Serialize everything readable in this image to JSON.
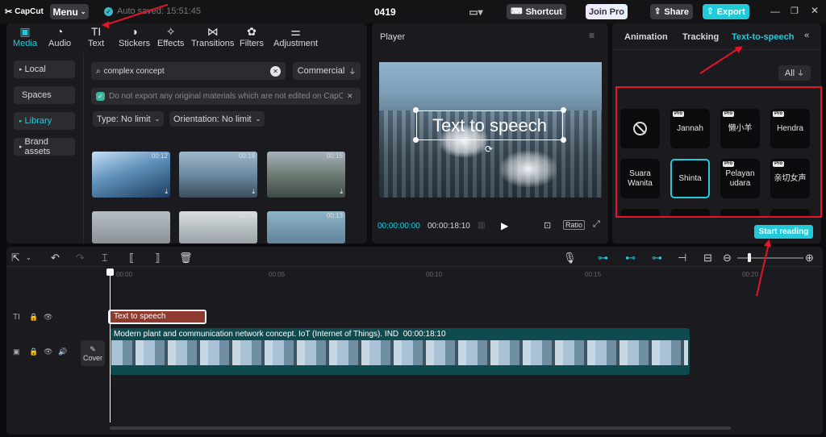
{
  "app": {
    "logo": "CapCut",
    "menu": "Menu",
    "autosave": "Auto saved: 15:51:45",
    "project": "0419",
    "shortcut": "Shortcut",
    "join_pro": "Join Pro",
    "share": "Share",
    "export": "Export"
  },
  "media_tabs": [
    {
      "label": "Media",
      "icon": "▣"
    },
    {
      "label": "Audio",
      "icon": "◔"
    },
    {
      "label": "Text",
      "icon": "TI"
    },
    {
      "label": "Stickers",
      "icon": "◑"
    },
    {
      "label": "Effects",
      "icon": "✧"
    },
    {
      "label": "Transitions",
      "icon": "⋈"
    },
    {
      "label": "Filters",
      "icon": "✿"
    },
    {
      "label": "Adjustment",
      "icon": "⚌"
    }
  ],
  "left_nav": [
    "Local",
    "Spaces",
    "Library",
    "Brand assets"
  ],
  "search": {
    "value": "complex concept",
    "filter_label": "Commercial"
  },
  "notice": "Do not export any original materials which are not edited on CapCut",
  "filters": {
    "type": "Type: No limit",
    "orientation": "Orientation: No limit"
  },
  "thumbs": [
    {
      "dur": "00:12"
    },
    {
      "dur": "00:19"
    },
    {
      "dur": "00:15"
    },
    {
      "dur": ""
    },
    {
      "dur": "00:10"
    },
    {
      "dur": "00:13"
    }
  ],
  "player": {
    "title": "Player",
    "overlay_text": "Text to speech",
    "time_current": "00:00:00:00",
    "time_total": "00:00:18:10",
    "ratio": "Ratio"
  },
  "right_tabs": [
    "Animation",
    "Tracking",
    "Text-to-speech"
  ],
  "voices_filter": "All",
  "voices": [
    {
      "name": "",
      "pro": false,
      "icon": "⃠"
    },
    {
      "name": "Jannah",
      "pro": true
    },
    {
      "name": "懒小羊",
      "pro": true
    },
    {
      "name": "Hendra",
      "pro": true
    },
    {
      "name": "Suara Wanita",
      "pro": false
    },
    {
      "name": "Shinta",
      "pro": false,
      "selected": true
    },
    {
      "name": "Pelayan udara",
      "pro": true
    },
    {
      "name": "亲切女声",
      "pro": true
    }
  ],
  "pro_label": "Pro",
  "start_reading": "Start reading",
  "timeline": {
    "ruler": [
      "00:00",
      "00:05",
      "00:10",
      "00:15",
      "00:20"
    ],
    "text_clip": "Text to speech",
    "video_clip": "Modern plant and communication network concept. IoT (Internet of Things). IND",
    "video_dur": "00:00:18:10",
    "cover": "Cover"
  },
  "colors": {
    "accent": "#22c9d8",
    "red_annotation": "#e4142a",
    "text_clip": "#8e3a2e",
    "video_clip": "#0f4a4f"
  }
}
